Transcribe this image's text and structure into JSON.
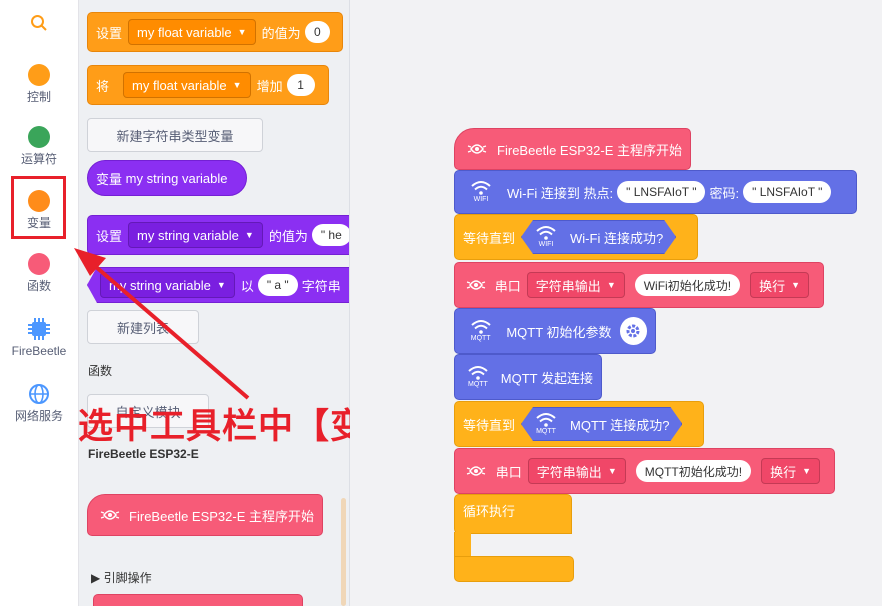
{
  "sidebar": {
    "items": [
      {
        "label": "",
        "color": "#ff9d18",
        "icon": "search-icon"
      },
      {
        "label": "控制",
        "color": "#ff9d18"
      },
      {
        "label": "运算符",
        "color": "#3aa55a"
      },
      {
        "label": "变量",
        "color": "#ff8c1a"
      },
      {
        "label": "函数",
        "color": "#f75b78"
      },
      {
        "label": "FireBeetle",
        "color": "#4c97ff",
        "icon": "chip-icon"
      },
      {
        "label": "网络服务",
        "color": "#4c97ff",
        "icon": "globe-icon"
      }
    ]
  },
  "flyout": {
    "set_float": {
      "prefix": "设置",
      "variable": "my float variable",
      "mid": "的值为",
      "value": "0"
    },
    "change_float": {
      "prefix": "将",
      "variable": "my float variable",
      "mid": "增加",
      "value": "1"
    },
    "new_string_var": "新建字符串类型变量",
    "string_reporter": {
      "prefix": "变量",
      "variable": "my string variable"
    },
    "set_string": {
      "prefix": "设置",
      "variable": "my string variable",
      "mid": "的值为",
      "value": "\" he"
    },
    "string_op": {
      "variable": "my string variable",
      "mid": "以",
      "value": "\" a \"",
      "suffix": "字符串"
    },
    "new_list": "新建列表",
    "functions_heading": "函数",
    "custom_block": "自定义模块",
    "device_heading": "FireBeetle ESP32-E",
    "start_block": "FireBeetle ESP32-E 主程序开始",
    "pin_ops": "引脚操作"
  },
  "caption": "选中工具栏中【变量】",
  "workspace": {
    "start": "FireBeetle ESP32-E 主程序开始",
    "wifi": {
      "label": "Wi-Fi 连接到 热点:",
      "ssid": "\" LNSFAIoT \"",
      "pwd_label": "密码:",
      "pwd": "\" LNSFAIoT \"",
      "badge": "WIFI"
    },
    "wait_wifi": {
      "prefix": "等待直到",
      "label": "Wi-Fi 连接成功?",
      "badge": "WIFI"
    },
    "serial1": {
      "prefix": "串口",
      "mode": "字符串输出",
      "text": "WiFi初始化成功!",
      "newline": "换行"
    },
    "mqtt_init": {
      "label": "MQTT 初始化参数",
      "badge": "MQTT"
    },
    "mqtt_connect": {
      "label": "MQTT 发起连接",
      "badge": "MQTT"
    },
    "wait_mqtt": {
      "prefix": "等待直到",
      "label": "MQTT 连接成功?",
      "badge": "MQTT"
    },
    "serial2": {
      "prefix": "串口",
      "mode": "字符串输出",
      "text": "MQTT初始化成功!",
      "newline": "换行"
    },
    "loop": "循环执行"
  }
}
